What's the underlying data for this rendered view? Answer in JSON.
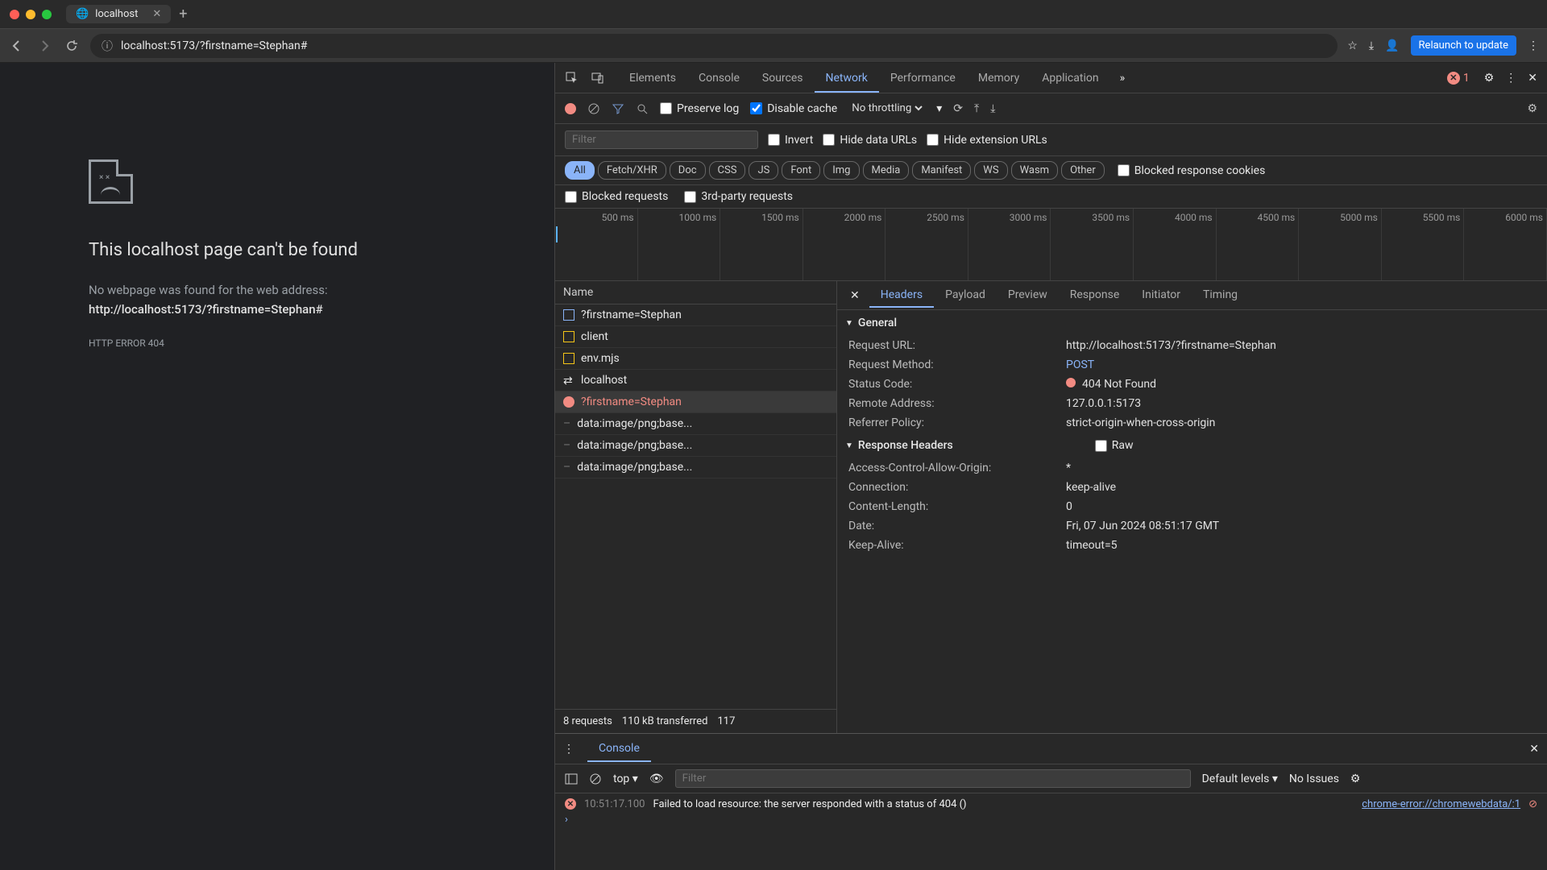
{
  "browser": {
    "tab_title": "localhost",
    "url": "localhost:5173/?firstname=Stephan#",
    "relaunch": "Relaunch to update"
  },
  "page": {
    "heading": "This localhost page can't be found",
    "message": "No webpage was found for the web address:",
    "address": "http://localhost:5173/?firstname=Stephan#",
    "error_code": "HTTP ERROR 404"
  },
  "devtools": {
    "tabs": [
      "Elements",
      "Console",
      "Sources",
      "Network",
      "Performance",
      "Memory",
      "Application"
    ],
    "active_tab": "Network",
    "error_count": "1",
    "toolbar": {
      "preserve_log": "Preserve log",
      "disable_cache": "Disable cache",
      "throttling": "No throttling",
      "filter_placeholder": "Filter",
      "invert": "Invert",
      "hide_data": "Hide data URLs",
      "hide_ext": "Hide extension URLs",
      "blocked_cookies": "Blocked response cookies",
      "blocked_req": "Blocked requests",
      "third_party": "3rd-party requests"
    },
    "chips": [
      "All",
      "Fetch/XHR",
      "Doc",
      "CSS",
      "JS",
      "Font",
      "Img",
      "Media",
      "Manifest",
      "WS",
      "Wasm",
      "Other"
    ],
    "timeline_ticks": [
      "500 ms",
      "1000 ms",
      "1500 ms",
      "2000 ms",
      "2500 ms",
      "3000 ms",
      "3500 ms",
      "4000 ms",
      "4500 ms",
      "5000 ms",
      "5500 ms",
      "6000 ms"
    ],
    "request_list_header": "Name",
    "requests": [
      {
        "name": "?firstname=Stephan",
        "icon": "doc",
        "err": false
      },
      {
        "name": "client",
        "icon": "js",
        "err": false
      },
      {
        "name": "env.mjs",
        "icon": "js",
        "err": false
      },
      {
        "name": "localhost",
        "icon": "ws",
        "err": false
      },
      {
        "name": "?firstname=Stephan",
        "icon": "err",
        "err": true
      },
      {
        "name": "data:image/png;base...",
        "icon": "none",
        "err": false
      },
      {
        "name": "data:image/png;base...",
        "icon": "none",
        "err": false
      },
      {
        "name": "data:image/png;base...",
        "icon": "none",
        "err": false
      }
    ],
    "footer": {
      "requests": "8 requests",
      "transferred": "110 kB transferred",
      "extra": "117"
    },
    "detail_tabs": [
      "Headers",
      "Payload",
      "Preview",
      "Response",
      "Initiator",
      "Timing"
    ],
    "detail_active": "Headers",
    "general_title": "General",
    "general": [
      {
        "k": "Request URL:",
        "v": "http://localhost:5173/?firstname=Stephan"
      },
      {
        "k": "Request Method:",
        "v": "POST",
        "cls": "post"
      },
      {
        "k": "Status Code:",
        "v": "404 Not Found",
        "status": true
      },
      {
        "k": "Remote Address:",
        "v": "127.0.0.1:5173"
      },
      {
        "k": "Referrer Policy:",
        "v": "strict-origin-when-cross-origin"
      }
    ],
    "response_headers_title": "Response Headers",
    "raw_label": "Raw",
    "response_headers": [
      {
        "k": "Access-Control-Allow-Origin:",
        "v": "*"
      },
      {
        "k": "Connection:",
        "v": "keep-alive"
      },
      {
        "k": "Content-Length:",
        "v": "0"
      },
      {
        "k": "Date:",
        "v": "Fri, 07 Jun 2024 08:51:17 GMT"
      },
      {
        "k": "Keep-Alive:",
        "v": "timeout=5"
      }
    ]
  },
  "drawer": {
    "tab": "Console",
    "context": "top",
    "filter_placeholder": "Filter",
    "levels": "Default levels",
    "issues": "No Issues",
    "log": {
      "time": "10:51:17.100",
      "message": "Failed to load resource: the server responded with a status of 404 ()",
      "source": "chrome-error://chromewebdata/:1"
    }
  }
}
